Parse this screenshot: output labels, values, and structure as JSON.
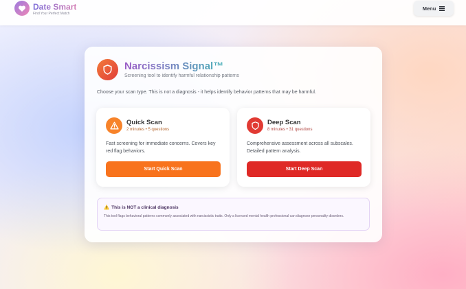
{
  "header": {
    "brand_name": "Date Smart",
    "brand_tagline": "Find Your Perfect Match",
    "menu_label": "Menu"
  },
  "tool": {
    "title": "Narcissism Signal™",
    "subtitle": "Screening tool to identify harmful relationship patterns",
    "intro": "Choose your scan type. This is not a diagnosis - it helps identify behavior patterns that may be harmful."
  },
  "scans": {
    "quick": {
      "title": "Quick Scan",
      "meta": "2 minutes • 5 questions",
      "description": "Fast screening for immediate concerns. Covers key red flag behaviors.",
      "button": "Start Quick Scan",
      "icon": "warning-triangle-icon",
      "color": "#f8731d"
    },
    "deep": {
      "title": "Deep Scan",
      "meta": "8 minutes • 31 questions",
      "description": "Comprehensive assessment across all subscales. Detailed pattern analysis.",
      "button": "Start Deep Scan",
      "icon": "shield-icon",
      "color": "#df2926"
    }
  },
  "notice": {
    "icon": "⚠️",
    "title": "This is NOT a clinical diagnosis",
    "body": "This tool flags behavioral patterns commonly associated with narcissistic traits. Only a licensed mental health professional can diagnose personality disorders."
  }
}
